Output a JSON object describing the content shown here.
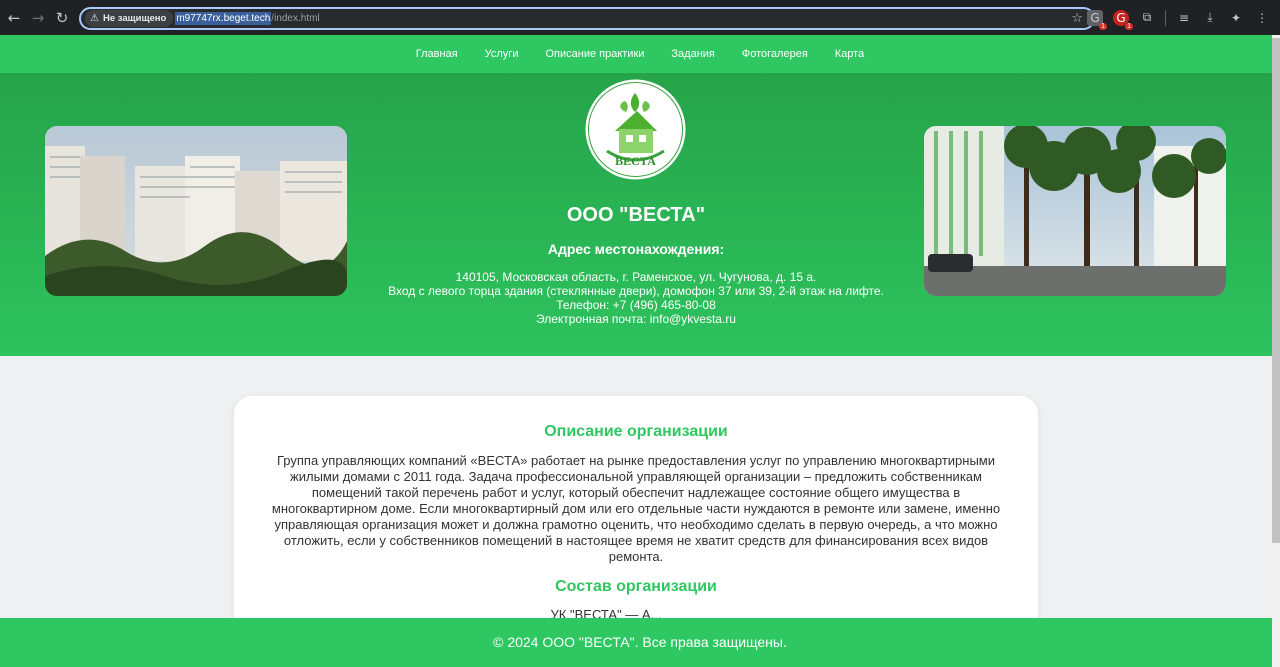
{
  "browser": {
    "security_label": "Не защищено",
    "url_host": "m97747rx.beget.tech",
    "url_path": "/index.html",
    "ext_badge_1": "1",
    "ext_badge_2": "1"
  },
  "nav": {
    "items": [
      {
        "label": "Главная"
      },
      {
        "label": "Услуги"
      },
      {
        "label": "Описание практики"
      },
      {
        "label": "Задания"
      },
      {
        "label": "Фотогалерея"
      },
      {
        "label": "Карта"
      }
    ]
  },
  "hero": {
    "logo_top_text": "ГРУППА УПРАВЛЯЮЩИХ КОМПАНИЙ",
    "logo_bottom_text": "ВЕСТА",
    "company_name": "ООО \"ВЕСТА\"",
    "address_title": "Адрес местонахождения:",
    "address_lines": [
      "140105, Московская область, г. Раменское, ул. Чугунова, д. 15 а.",
      "Вход с левого торца здания (стеклянные двери), домофон 37 или 39, 2-й этаж на лифте.",
      "Телефон: +7 (496) 465-80-08",
      "Электронная почта: info@ykvesta.ru"
    ]
  },
  "content": {
    "about_title": "Описание организации",
    "about_text": "Группа управляющих компаний «ВЕСТА» работает на рынке предоставления услуг по управлению многоквартирными жилыми домами с 2011 года. Задача профессиональной управляющей организации – предложить собственникам помещений такой перечень работ и услуг, который обеспечит надлежащее состояние общего имущества в многоквартирном доме. Если многоквартирный дом или его отдельные части нуждаются в ремонте или замене, именно управляющая организация может и должна грамотно оценить, что необходимо сделать в первую очередь, а что можно отложить, если у собственников помещений в настоящее время не хватит средств для финансирования всех видов ремонта.",
    "composition_title": "Состав организации",
    "composition_partial": "УК \"ВЕСТА\" — А..."
  },
  "footer": {
    "text": "© 2024 ООО \"ВЕСТА\". Все права защищены."
  },
  "colors": {
    "brand_green": "#2ec761",
    "hero_green_dark": "#26a349",
    "chrome_bg": "#202124"
  }
}
